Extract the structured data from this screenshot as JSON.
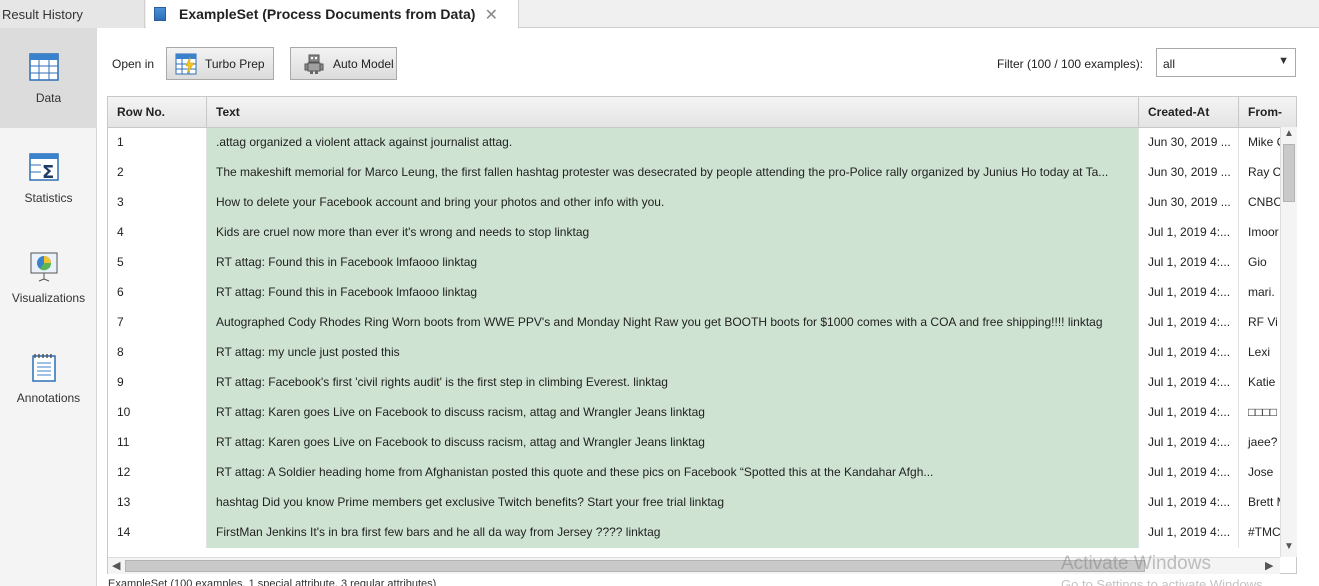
{
  "tabs": {
    "history_label": "Result History",
    "example_label": "ExampleSet (Process Documents from Data)",
    "close_glyph": "✕"
  },
  "nav": {
    "items": [
      {
        "label": "Data"
      },
      {
        "label": "Statistics"
      },
      {
        "label": "Visualizations"
      },
      {
        "label": "Annotations"
      }
    ]
  },
  "toolbar": {
    "open_in_label": "Open in",
    "turbo_prep_label": "Turbo Prep",
    "auto_model_label": "Auto Model",
    "filter_label": "Filter (100 / 100 examples):",
    "filter_value": "all"
  },
  "table": {
    "headers": [
      "Row No.",
      "Text",
      "Created-At",
      "From-"
    ],
    "rows": [
      [
        "1",
        ".attag organized a violent attack against journalist attag.",
        "Jun 30, 2019 ...",
        "Mike C"
      ],
      [
        "2",
        "The makeshift memorial for Marco Leung, the first fallen hashtag protester was desecrated by people attending the pro-Police rally organized by Junius Ho today at Ta...",
        "Jun 30, 2019 ...",
        "Ray C"
      ],
      [
        "3",
        "How to delete your Facebook account and bring your photos and other info with you.",
        "Jun 30, 2019 ...",
        "CNBC"
      ],
      [
        "4",
        "Kids are cruel now more than ever it's wrong and needs to stop linktag",
        "Jul 1, 2019 4:...",
        "Imoor"
      ],
      [
        "5",
        "RT attag: Found this in Facebook lmfaooo linktag",
        "Jul 1, 2019 4:...",
        "Gio"
      ],
      [
        "6",
        "RT attag: Found this in Facebook lmfaooo linktag",
        "Jul 1, 2019 4:...",
        "mari."
      ],
      [
        "7",
        "Autographed Cody Rhodes Ring Worn boots from WWE PPV's and Monday Night Raw you get BOOTH boots for $1000 comes with a COA and free shipping!!!! linktag",
        "Jul 1, 2019 4:...",
        "RF Vi"
      ],
      [
        "8",
        "RT attag: my uncle just posted this",
        "Jul 1, 2019 4:...",
        "Lexi"
      ],
      [
        "9",
        "RT attag: Facebook's first 'civil rights audit' is the first step in climbing Everest. linktag",
        "Jul 1, 2019 4:...",
        "Katie"
      ],
      [
        "10",
        "RT attag: Karen goes Live on Facebook to discuss racism, attag and Wrangler Jeans linktag",
        "Jul 1, 2019 4:...",
        "□□□□"
      ],
      [
        "11",
        "RT attag: Karen goes Live on Facebook to discuss racism, attag and Wrangler Jeans linktag",
        "Jul 1, 2019 4:...",
        "jaee?"
      ],
      [
        "12",
        "RT attag: A Soldier heading home from Afghanistan posted this quote and these pics on Facebook “Spotted this at the Kandahar Afgh...",
        "Jul 1, 2019 4:...",
        "Jose"
      ],
      [
        "13",
        "hashtag Did you know Prime members get exclusive Twitch benefits? Start your free trial linktag",
        "Jul 1, 2019 4:...",
        "Brett M"
      ],
      [
        "14",
        "FirstMan Jenkins It's in bra first few bars and he all da way from Jersey ???? linktag",
        "Jul 1, 2019 4:...",
        "#TMC"
      ]
    ]
  },
  "status": {
    "footer_text": "ExampleSet (100 examples, 1 special attribute, 3 regular attributes)"
  },
  "watermark": {
    "line1": "Activate Windows",
    "line2": "Go to Settings to activate Windows."
  },
  "colors": {
    "text_column_bg": "#cfe3d2",
    "active_nav_bg": "#dcdcdc",
    "accent_blue": "#2c6fb7"
  }
}
